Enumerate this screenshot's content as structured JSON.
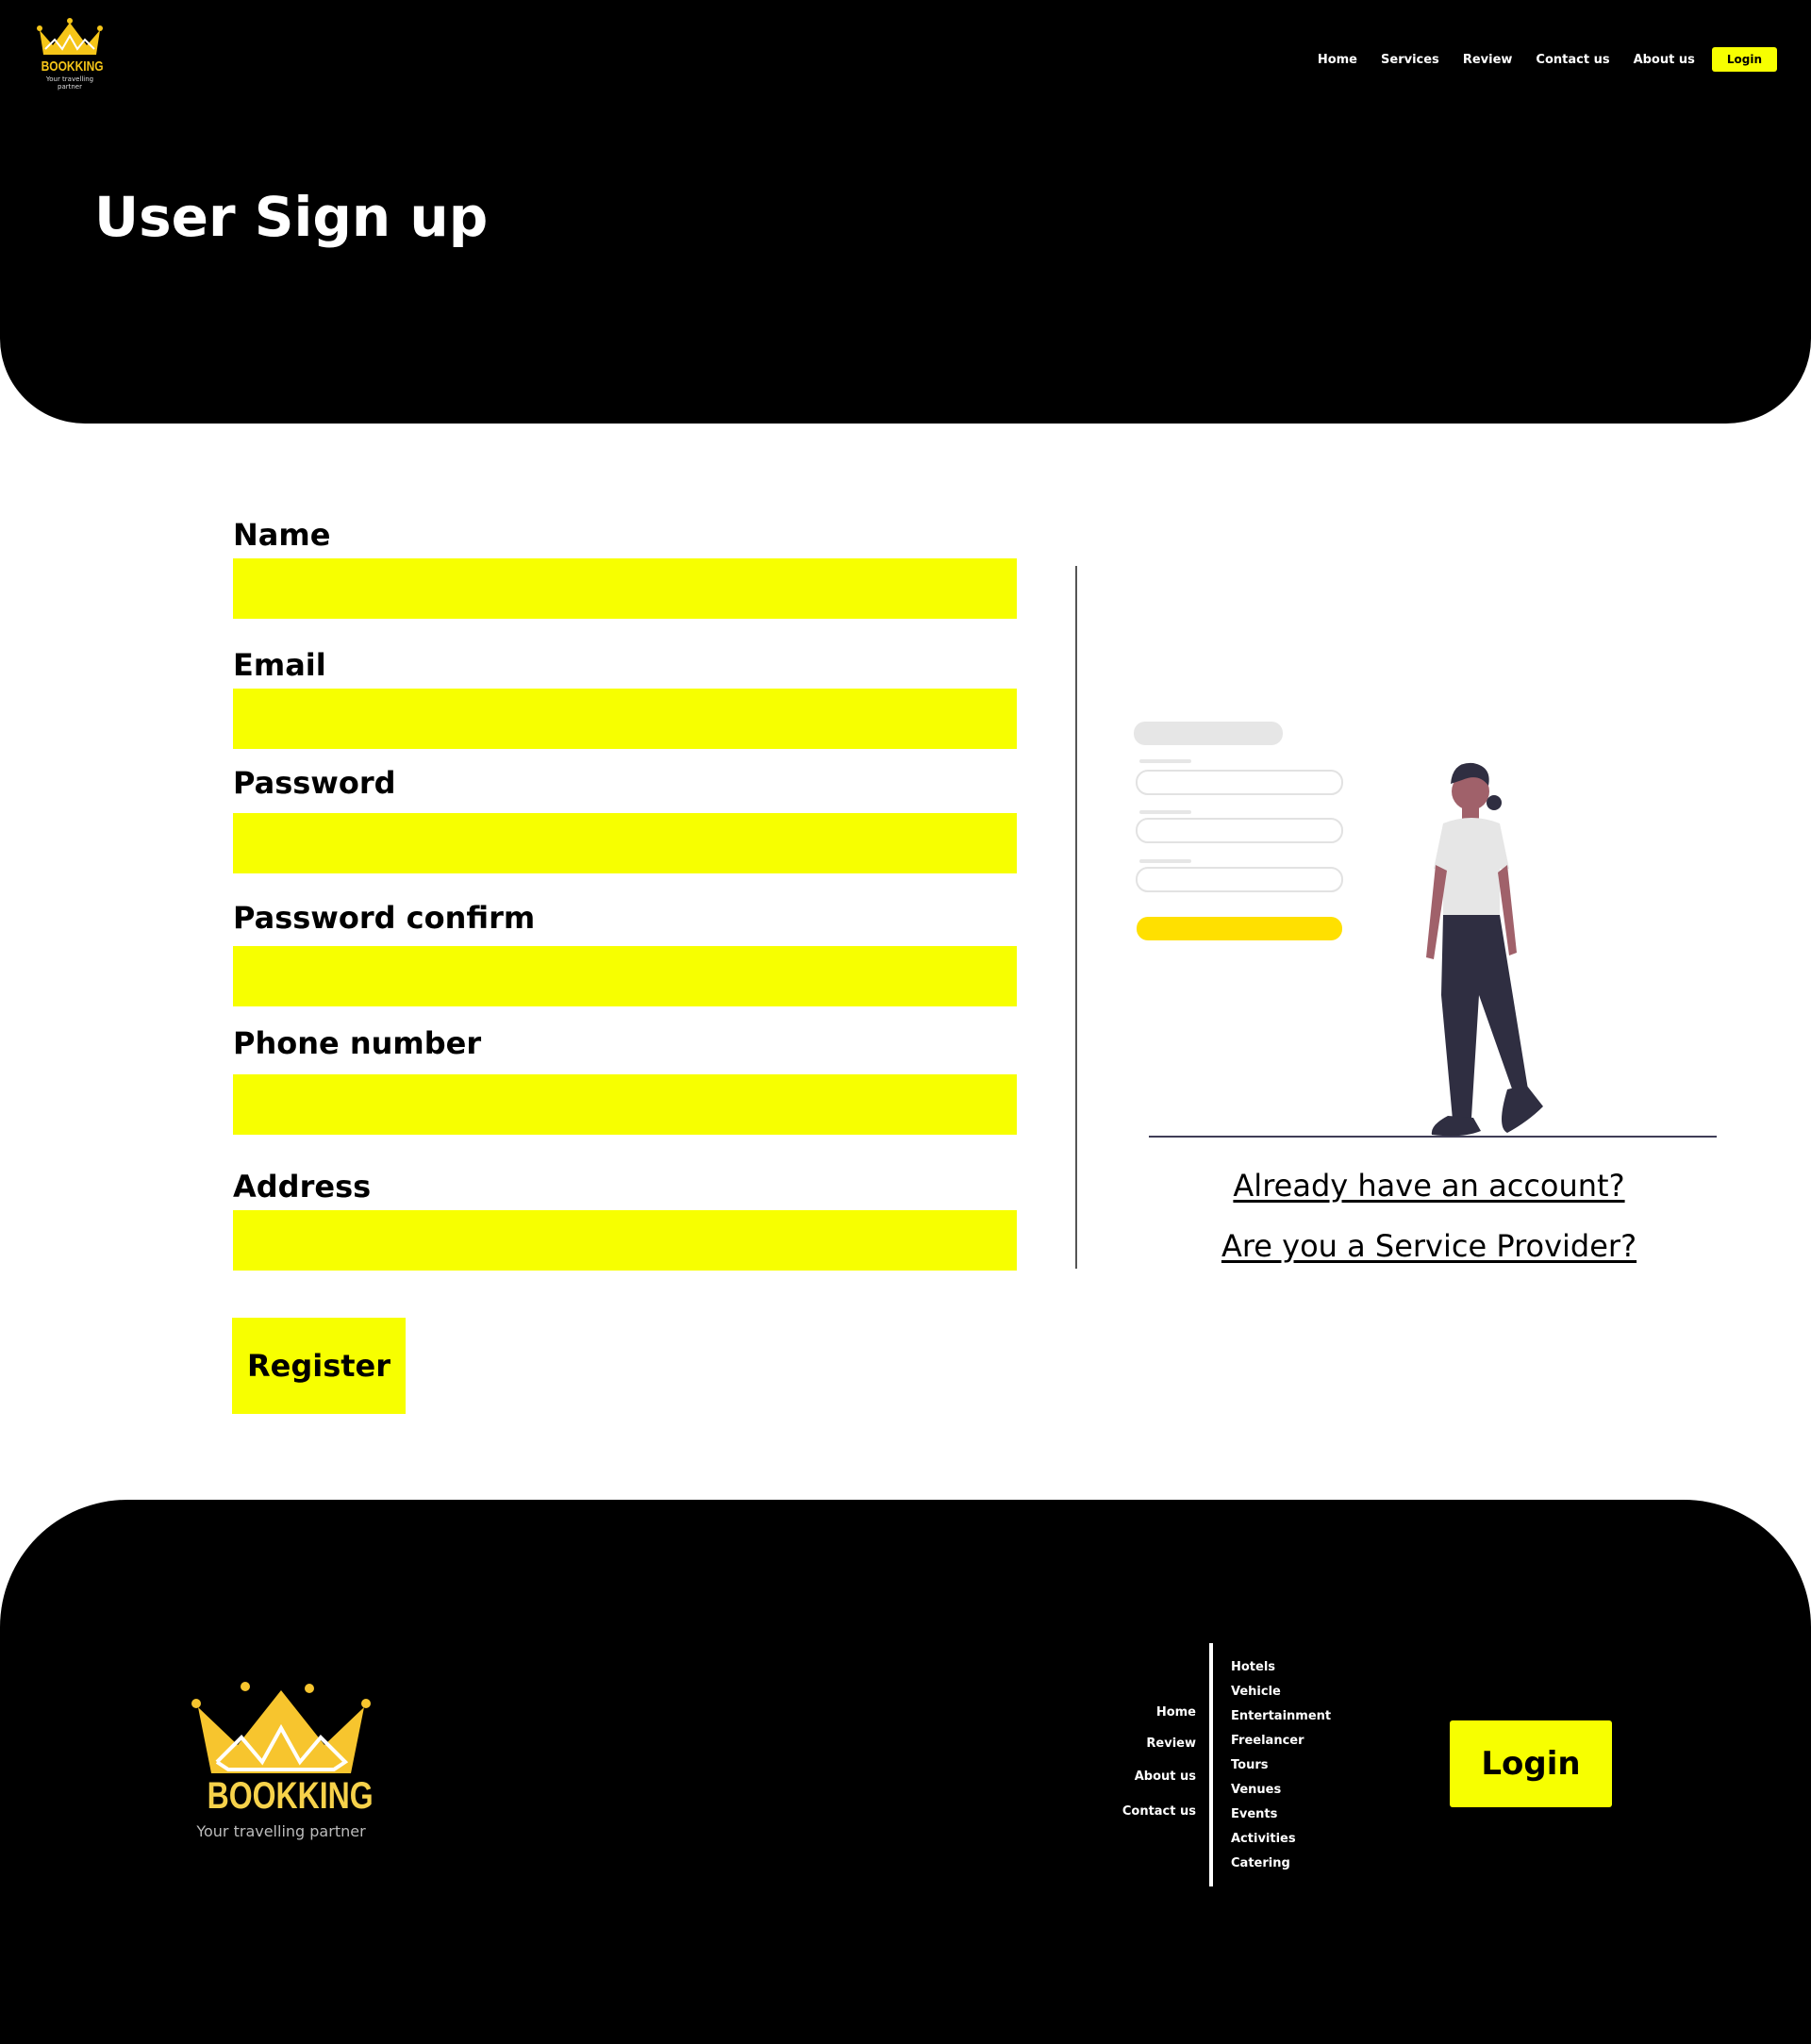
{
  "brand": {
    "name": "BOOKKING",
    "tagline": "Your travelling partner"
  },
  "nav": {
    "items": [
      "Home",
      "Services",
      "Review",
      "Contact us",
      "About us"
    ],
    "login": "Login"
  },
  "page": {
    "title": "User Sign up"
  },
  "form": {
    "fields": [
      {
        "label": "Name",
        "value": ""
      },
      {
        "label": "Email",
        "value": ""
      },
      {
        "label": "Password",
        "value": ""
      },
      {
        "label": "Password confirm",
        "value": ""
      },
      {
        "label": "Phone number",
        "value": ""
      },
      {
        "label": "Address",
        "value": ""
      }
    ],
    "submit": "Register"
  },
  "links": {
    "login": "Already have an account?",
    "provider": "Are you a Service Provider?"
  },
  "footer": {
    "nav_left": [
      "Home",
      "Review",
      "About us",
      "Contact us"
    ],
    "nav_right": [
      "Hotels",
      "Vehicle",
      "Entertainment",
      "Freelancer",
      "Tours",
      "Venues",
      "Events",
      "Activities",
      "Catering"
    ],
    "login": "Login"
  },
  "colors": {
    "accent": "#f7ff00",
    "dark": "#000000",
    "crown": "#f5c518"
  }
}
